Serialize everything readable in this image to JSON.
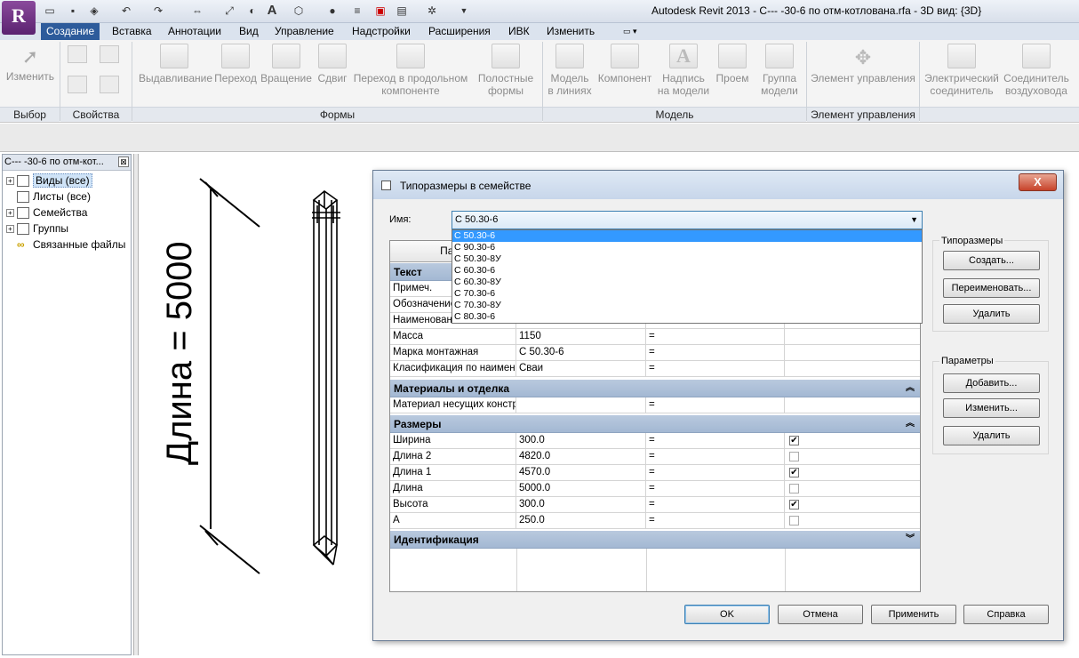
{
  "app": {
    "logo_letter": "R",
    "window_title": "Autodesk Revit 2013 -     С--- -30-6 по отм-котлована.rfa - 3D вид: {3D}"
  },
  "tabs": [
    "Создание",
    "Вставка",
    "Аннотации",
    "Вид",
    "Управление",
    "Надстройки",
    "Расширения",
    "ИВК",
    "Изменить"
  ],
  "active_tab": "Создание",
  "ribbon": {
    "modify": "Изменить",
    "extrusion": "Выдавливание",
    "blend": "Переход",
    "revolve": "Вращение",
    "sweep": "Сдвиг",
    "swept_blend_1": "Переход в продольном",
    "swept_blend_2": "компоненте",
    "void_1": "Полостные",
    "void_2": "формы",
    "model_line_1": "Модель",
    "model_line_2": "в линиях",
    "component": "Компонент",
    "model_text_1": "Надпись",
    "model_text_2": "на модели",
    "opening": "Проем",
    "model_group_1": "Группа",
    "model_group_2": "модели",
    "control": "Элемент управления",
    "elec_1": "Электрический",
    "elec_2": "соединитель",
    "duct_1": "Соединитель",
    "duct_2": "воздуховода",
    "panels": {
      "select": "Выбор",
      "properties": "Свойства",
      "forms": "Формы",
      "model": "Модель",
      "control": "Элемент управления"
    }
  },
  "browser": {
    "title": "С--- -30-6 по отм-кот...",
    "close": "⊠",
    "items": [
      {
        "label": "Виды (все)"
      },
      {
        "label": "Листы (все)"
      },
      {
        "label": "Семейства"
      },
      {
        "label": "Группы"
      },
      {
        "label": "Связанные файлы"
      }
    ]
  },
  "view": {
    "dimension_text": "Длина = 5000"
  },
  "dialog": {
    "title": "Типоразмеры в семействе",
    "close": "X",
    "name_label": "Имя:",
    "name_value": "С 50.30-6",
    "dropdown_options": [
      "С 50.30-6",
      "С 90.30-6",
      "С 50.30-8У",
      "С 60.30-6",
      "С 60.30-8У",
      "С 70.30-6",
      "С 70.30-8У",
      "С 80.30-6"
    ],
    "header_param": "Пара",
    "groups": {
      "text": "Текст",
      "materials": "Материалы и отделка",
      "dimensions": "Размеры",
      "identification": "Идентификация"
    },
    "text_rows": [
      {
        "name": "Примеч.",
        "value": "",
        "eq": ""
      },
      {
        "name": "Обозначение",
        "value": "",
        "eq": ""
      },
      {
        "name": "Наименование",
        "value": "",
        "eq": ""
      },
      {
        "name": "Масса",
        "value": "1150",
        "eq": "="
      },
      {
        "name": "Марка монтажная",
        "value": "С 50.30-6",
        "eq": "="
      },
      {
        "name": "Класификация по наименованию",
        "value": "Сваи",
        "eq": "="
      }
    ],
    "material_rows": [
      {
        "name": "Материал несущих конструкций",
        "value": "",
        "eq": "="
      }
    ],
    "dim_rows": [
      {
        "name": "Ширина",
        "value": "300.0",
        "eq": "=",
        "checked": true
      },
      {
        "name": "Длина 2",
        "value": "4820.0",
        "eq": "=",
        "checked": false
      },
      {
        "name": "Длина 1",
        "value": "4570.0",
        "eq": "=",
        "checked": true
      },
      {
        "name": "Длина",
        "value": "5000.0",
        "eq": "=",
        "checked": false
      },
      {
        "name": "Высота",
        "value": "300.0",
        "eq": "=",
        "checked": true
      },
      {
        "name": "A",
        "value": "250.0",
        "eq": "=",
        "checked": false
      }
    ],
    "types_label": "Типоразмеры",
    "create": "Создать...",
    "rename": "Переименовать...",
    "delete_type": "Удалить",
    "params_label": "Параметры",
    "add": "Добавить...",
    "modify": "Изменить...",
    "delete_param": "Удалить",
    "ok": "OK",
    "cancel": "Отмена",
    "apply": "Применить",
    "help": "Справка"
  }
}
